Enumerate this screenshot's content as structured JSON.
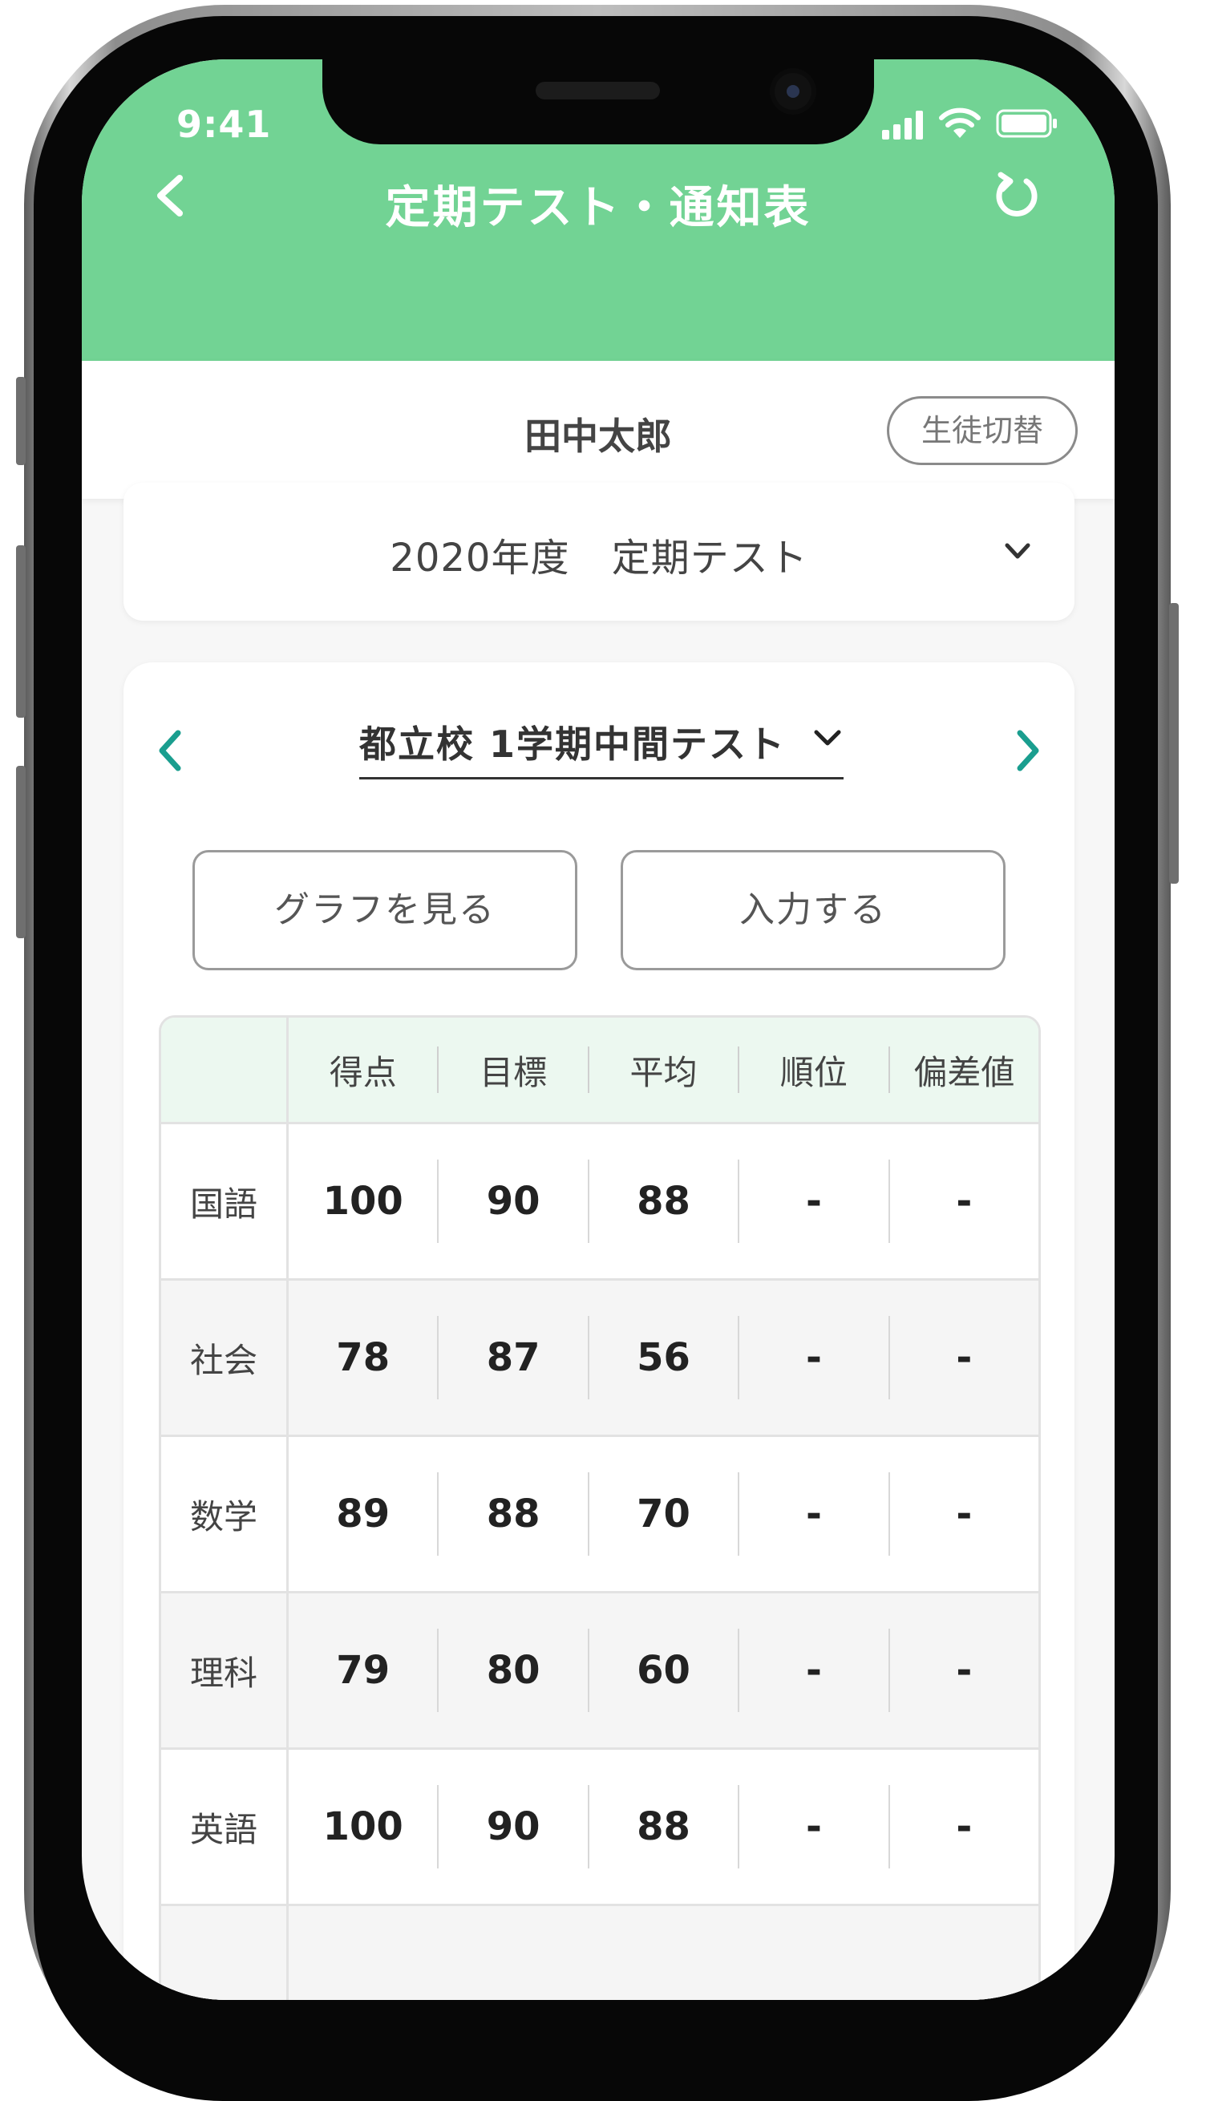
{
  "status": {
    "time": "9:41"
  },
  "nav": {
    "title": "定期テスト・通知表"
  },
  "student": {
    "name": "田中太郎",
    "switch_label": "生徒切替"
  },
  "year_selector": {
    "label": "2020年度 定期テスト"
  },
  "test_selector": {
    "label": "都立校 1学期中間テスト"
  },
  "actions": {
    "graph_label": "グラフを見る",
    "input_label": "入力する"
  },
  "table": {
    "headers": [
      "得点",
      "目標",
      "平均",
      "順位",
      "偏差値"
    ],
    "rows": [
      {
        "subject": "国語",
        "values": [
          "100",
          "90",
          "88",
          "-",
          "-"
        ]
      },
      {
        "subject": "社会",
        "values": [
          "78",
          "87",
          "56",
          "-",
          "-"
        ]
      },
      {
        "subject": "数学",
        "values": [
          "89",
          "88",
          "70",
          "-",
          "-"
        ]
      },
      {
        "subject": "理科",
        "values": [
          "79",
          "80",
          "60",
          "-",
          "-"
        ]
      },
      {
        "subject": "英語",
        "values": [
          "100",
          "90",
          "88",
          "-",
          "-"
        ]
      }
    ]
  },
  "colors": {
    "header_green": "#72d394",
    "accent_teal": "#1a9e8f",
    "table_head_bg": "#ecf8f0"
  }
}
